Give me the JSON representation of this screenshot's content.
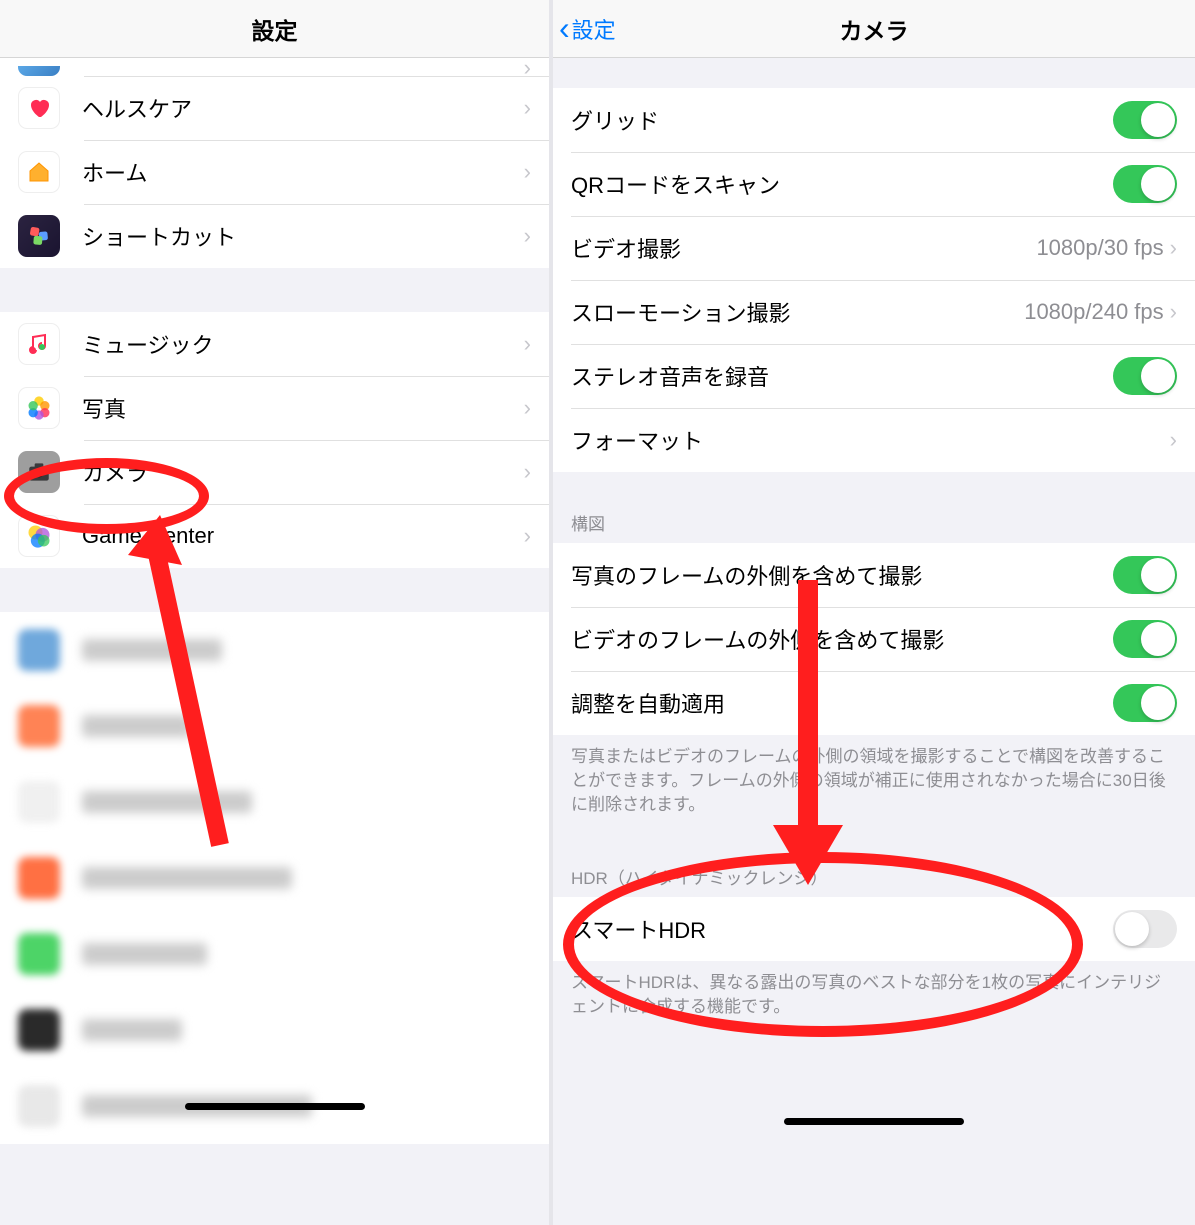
{
  "left": {
    "title": "設定",
    "group1": [
      {
        "label": "ヘルスケア"
      },
      {
        "label": "ホーム"
      },
      {
        "label": "ショートカット"
      }
    ],
    "group2": [
      {
        "label": "ミュージック"
      },
      {
        "label": "写真"
      },
      {
        "label": "カメラ"
      },
      {
        "label": "Game Center"
      }
    ]
  },
  "right": {
    "back": "設定",
    "title": "カメラ",
    "section1": [
      {
        "label": "グリッド",
        "type": "toggle",
        "on": true
      },
      {
        "label": "QRコードをスキャン",
        "type": "toggle",
        "on": true
      },
      {
        "label": "ビデオ撮影",
        "type": "link",
        "value": "1080p/30 fps"
      },
      {
        "label": "スローモーション撮影",
        "type": "link",
        "value": "1080p/240 fps"
      },
      {
        "label": "ステレオ音声を録音",
        "type": "toggle",
        "on": true
      },
      {
        "label": "フォーマット",
        "type": "link",
        "value": ""
      }
    ],
    "composition_header": "構図",
    "section2": [
      {
        "label": "写真のフレームの外側を含めて撮影",
        "type": "toggle",
        "on": true
      },
      {
        "label": "ビデオのフレームの外側を含めて撮影",
        "type": "toggle",
        "on": true
      },
      {
        "label": "調整を自動適用",
        "type": "toggle",
        "on": true
      }
    ],
    "composition_footer": "写真またはビデオのフレームの外側の領域を撮影することで構図を改善することができます。フレームの外側の領域が補正に使用されなかった場合に30日後に削除されます。",
    "hdr_header": "HDR（ハイダイナミックレンジ）",
    "section3": [
      {
        "label": "スマートHDR",
        "type": "toggle",
        "on": false
      }
    ],
    "hdr_footer": "スマートHDRは、異なる露出の写真のベストな部分を1枚の写真にインテリジェントに合成する機能です。"
  }
}
